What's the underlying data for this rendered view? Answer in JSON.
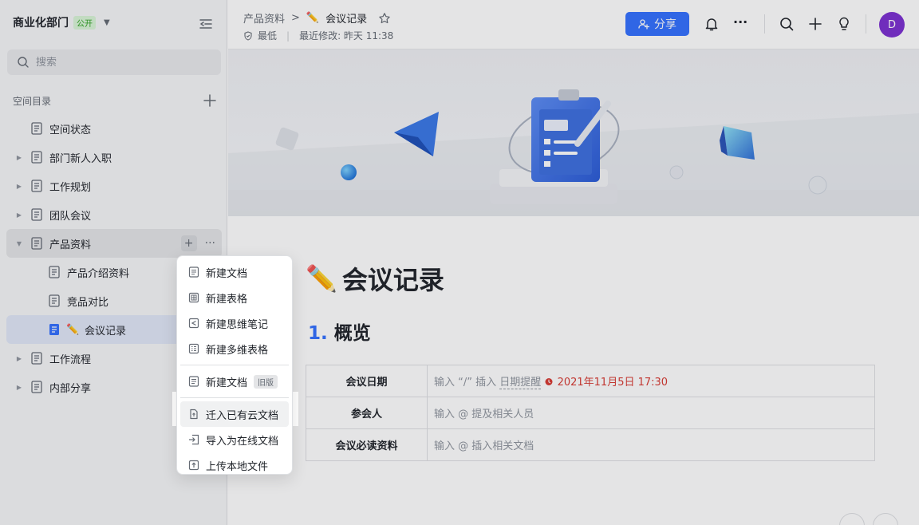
{
  "sidebar": {
    "space_name": "商业化部门",
    "public_badge": "公开",
    "search_placeholder": "搜索",
    "dir_label": "空间目录",
    "items": [
      {
        "label": "空间状态",
        "arrow": ""
      },
      {
        "label": "部门新人入职",
        "arrow": "▶"
      },
      {
        "label": "工作规划",
        "arrow": "▶"
      },
      {
        "label": "团队会议",
        "arrow": "▶"
      },
      {
        "label": "产品资料",
        "arrow": "▼"
      },
      {
        "label": "产品介绍资料",
        "arrow": ""
      },
      {
        "label": "竞品对比",
        "arrow": ""
      },
      {
        "label": "会议记录",
        "emoji": "✏️",
        "arrow": ""
      },
      {
        "label": "工作流程",
        "arrow": "▶"
      },
      {
        "label": "内部分享",
        "arrow": "▶"
      }
    ]
  },
  "menu": {
    "items": [
      {
        "label": "新建文档",
        "icon": "doc-icon"
      },
      {
        "label": "新建表格",
        "icon": "sheet-icon"
      },
      {
        "label": "新建思维笔记",
        "icon": "mindnote-icon"
      },
      {
        "label": "新建多维表格",
        "icon": "bitable-icon"
      },
      {
        "label": "新建文档",
        "icon": "doc-icon",
        "tag": "旧版"
      },
      {
        "label": "迁入已有云文档",
        "icon": "move-in-icon"
      },
      {
        "label": "导入为在线文档",
        "icon": "import-icon"
      },
      {
        "label": "上传本地文件",
        "icon": "upload-icon"
      }
    ]
  },
  "header": {
    "breadcrumb_parent": "产品资料",
    "breadcrumb_sep": ">",
    "current_emoji": "✏️",
    "current_title": "会议记录",
    "permission": "最低",
    "last_modified": "最近修改: 昨天 11:38",
    "share_label": "分享",
    "more": "···",
    "avatar_initial": "D"
  },
  "document": {
    "title_emoji": "✏️",
    "title": "会议记录",
    "h1_number": "1.",
    "h1_text": "概览",
    "table": [
      {
        "key": "会议日期",
        "prefix": "输入 “/” 插入",
        "dotted": "日期提醒",
        "date": "2021年11月5日 17:30"
      },
      {
        "key": "参会人",
        "value": "输入 @ 提及相关人员"
      },
      {
        "key": "会议必读资料",
        "value": "输入 @ 插入相关文档"
      }
    ]
  },
  "colors": {
    "accent": "#3370ff",
    "avatar": "#7b2fd1",
    "date_red": "#d83931",
    "public_green": "#2ea121"
  }
}
